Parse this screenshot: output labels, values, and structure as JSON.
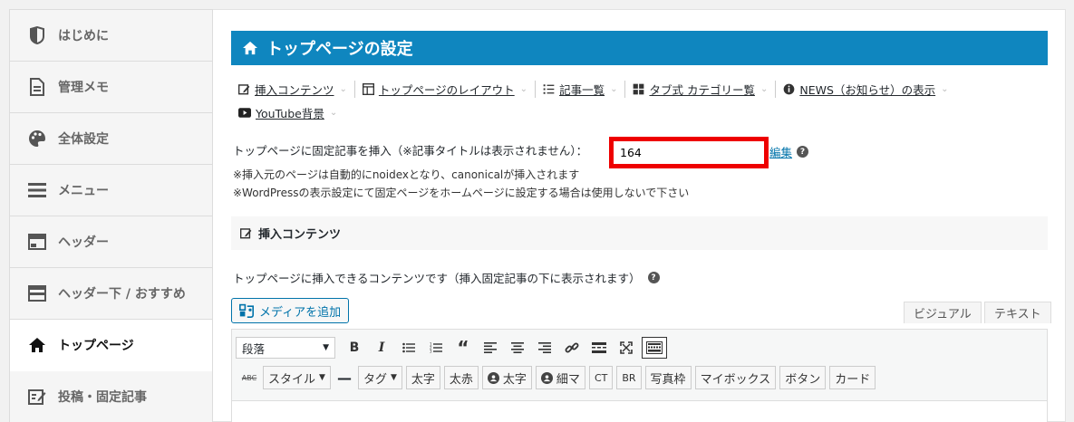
{
  "sidebar": {
    "items": [
      {
        "label": "はじめに",
        "icon": "leaf-icon"
      },
      {
        "label": "管理メモ",
        "icon": "document-icon"
      },
      {
        "label": "全体設定",
        "icon": "palette-icon"
      },
      {
        "label": "メニュー",
        "icon": "menu-icon"
      },
      {
        "label": "ヘッダー",
        "icon": "header-icon"
      },
      {
        "label": "ヘッダー下 / おすすめ",
        "icon": "header-below-icon"
      },
      {
        "label": "トップページ",
        "icon": "home-icon",
        "active": true
      },
      {
        "label": "投稿・固定記事",
        "icon": "edit-icon"
      }
    ]
  },
  "main": {
    "title": "トップページの設定",
    "tabs": [
      {
        "label": "挿入コンテンツ",
        "icon": "edit-icon"
      },
      {
        "label": "トップページのレイアウト",
        "icon": "layout-icon"
      },
      {
        "label": "記事一覧",
        "icon": "list-icon"
      },
      {
        "label": "タブ式 カテゴリー覧",
        "icon": "grid-icon"
      },
      {
        "label": "NEWS（お知らせ）の表示",
        "icon": "info-icon"
      },
      {
        "label": "YouTube背景",
        "icon": "youtube-icon"
      }
    ],
    "fixed_label": "トップページに固定記事を挿入（※記事タイトルは表示されません）：",
    "fixed_value": "164",
    "edit_link": "編集",
    "note1": "※挿入元のページは自動的にnoidexとなり、canonicalが挿入されます",
    "note2": "※WordPressの表示設定にて固定ページをホームページに設定する場合は使用しないで下さい",
    "section_title": "挿入コンテンツ",
    "section_desc": "トップページに挿入できるコンテンツです（挿入固定記事の下に表示されます）",
    "media_button": "メディアを追加",
    "visual_tab": "ビジュアル",
    "text_tab": "テキスト",
    "format_select": "段落",
    "quicktags": {
      "style": "スタイル",
      "tag": "タグ",
      "bold1": "太字",
      "bold_red": "太赤",
      "circle_bold": "太字",
      "circle_thin": "細マ",
      "ct": "CT",
      "br": "BR",
      "photo_frame": "写真枠",
      "mybox": "マイボックス",
      "button": "ボタン",
      "card": "カード"
    }
  },
  "colors": {
    "title_bar": "#0f86bf",
    "highlight_box": "#ee0000",
    "link": "#0073aa"
  }
}
